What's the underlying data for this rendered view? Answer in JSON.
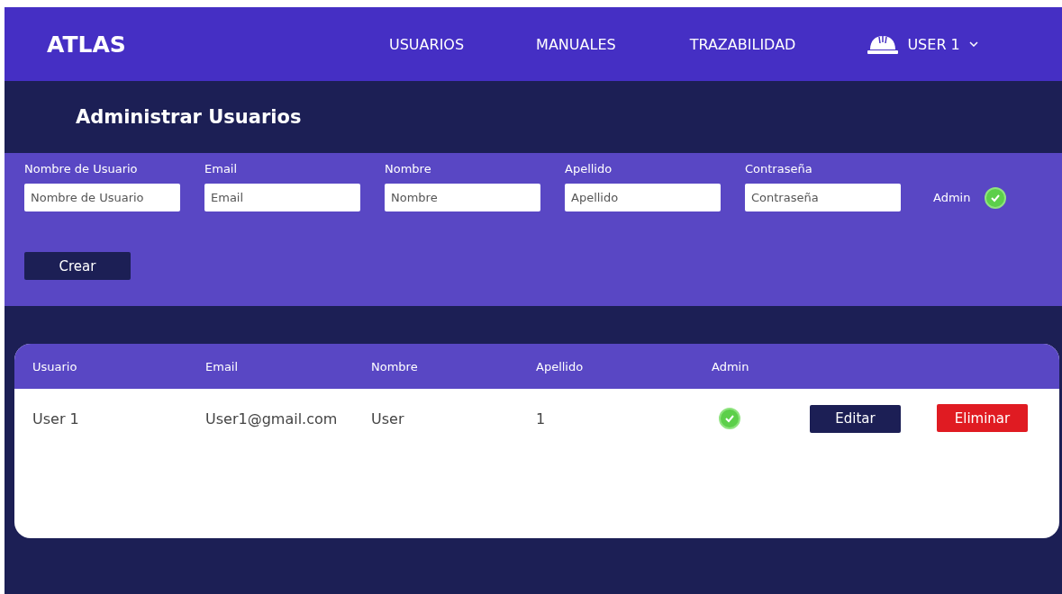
{
  "navbar": {
    "brand": "ATLAS",
    "links": [
      "USUARIOS",
      "MANUALES",
      "TRAZABILIDAD"
    ],
    "user": "USER 1"
  },
  "page_title": "Administrar Usuarios",
  "form": {
    "fields": [
      {
        "label": "Nombre de Usuario",
        "placeholder": "Nombre de Usuario"
      },
      {
        "label": "Email",
        "placeholder": "Email"
      },
      {
        "label": "Nombre",
        "placeholder": "Nombre"
      },
      {
        "label": "Apellido",
        "placeholder": "Apellido"
      },
      {
        "label": "Contraseña",
        "placeholder": "Contraseña"
      }
    ],
    "admin": {
      "label": "Admin",
      "checked": true
    },
    "submit": "Crear"
  },
  "table": {
    "columns": [
      "Usuario",
      "Email",
      "Nombre",
      "Apellido",
      "Admin"
    ],
    "rows": [
      {
        "cells": [
          "User 1",
          "User1@gmail.com",
          "User",
          "1"
        ],
        "admin": true,
        "actions": [
          "Editar",
          "Eliminar"
        ]
      }
    ]
  }
}
